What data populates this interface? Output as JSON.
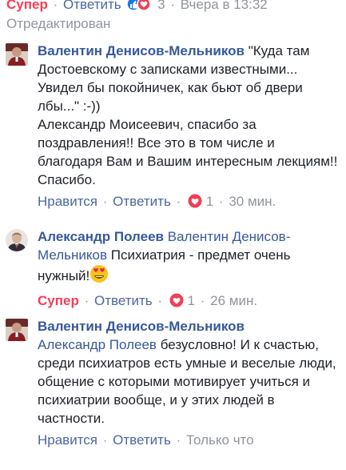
{
  "top": {
    "reaction_label": "Супер",
    "reply_label": "Ответить",
    "reaction_count": "3",
    "timestamp": "Вчера в 13:32",
    "edited": "Отредактирован"
  },
  "comments": [
    {
      "author": "Валентин Денисов-Мельников",
      "text1": "\"Куда там Достоевскому с записками известными... Увидел бы покойничек, как бьют об двери лбы...\" :-))",
      "text2": "Александр Моисеевич, спасибо за поздравления!! Все это в том числе и благодаря Вам и Вашим интересным лекциям!! Спасибо.",
      "like_label": "Нравится",
      "reply_label": "Ответить",
      "reaction_count": "1",
      "time": "30 мин."
    },
    {
      "author": "Александр Полеев",
      "mention": "Валентин Денисов-Мельников",
      "text": "Психиатрия - предмет очень нужный!",
      "like_label": "Супер",
      "reply_label": "Ответить",
      "reaction_count": "1",
      "time": "26 мин."
    },
    {
      "author": "Валентин Денисов-Мельников",
      "mention": "Александр Полеев",
      "text": "безусловно! И к счастью, среди психиатров есть умные и веселые люди, общение с которыми мотивирует учиться и психиатрии вообще, и у этих людей в частности.",
      "like_label": "Нравится",
      "reply_label": "Ответить",
      "time": "Только что"
    }
  ],
  "colors": {
    "link": "#4b67a1",
    "author": "#385898",
    "super_red": "#f33e58",
    "muted": "#90949c"
  }
}
